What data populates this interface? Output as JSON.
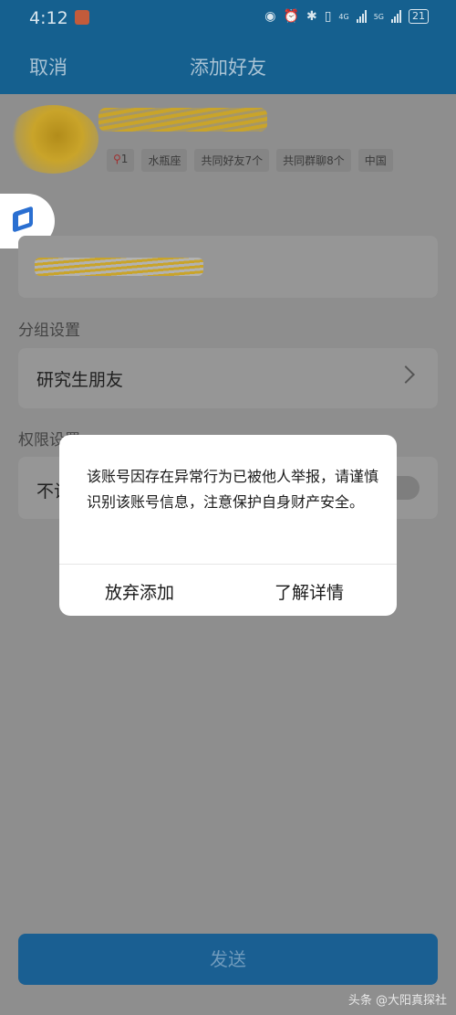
{
  "status_bar": {
    "time": "4:12",
    "icons": [
      "eye-icon",
      "alarm-icon",
      "bluetooth-icon",
      "vibrate-icon",
      "signal-4g-icon",
      "signal-5g-icon"
    ],
    "net1": "4G",
    "net2": "5G",
    "battery": "21"
  },
  "nav": {
    "cancel_label": "取消",
    "title": "添加好友"
  },
  "profile": {
    "tags": [
      "1",
      "水瓶座",
      "共同好友7个",
      "共同群聊8个",
      "中国"
    ]
  },
  "sections": {
    "group_label": "分组设置",
    "group_value": "研究生朋友",
    "permission_label": "权限设置",
    "permission_value": "不让"
  },
  "dialog": {
    "message": "该账号因存在异常行为已被他人举报，请谨慎识别该账号信息，注意保护自身财产安全。",
    "cancel_label": "放弃添加",
    "details_label": "了解详情"
  },
  "send_label": "发送",
  "watermark": "头条 @大阳真探社",
  "colors": {
    "accent": "#15608f",
    "overlay": "#8e8e8e",
    "dialog_bg": "#ffffff"
  }
}
